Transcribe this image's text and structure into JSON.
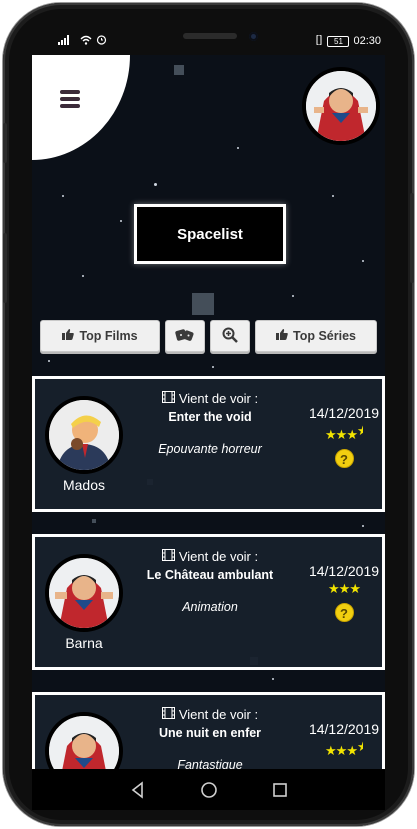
{
  "status": {
    "signal": "4G",
    "carrier_icons": "wifi alarm",
    "battery": "51",
    "time": "02:30"
  },
  "app": {
    "title": "Spacelist"
  },
  "buttons": {
    "top_films": "Top Films",
    "top_series": "Top Séries",
    "random_icon": "dice-icon",
    "search_icon": "zoom-in-icon"
  },
  "cards": [
    {
      "user": "Mados",
      "label": "Vient de voir :",
      "film": "Enter the void",
      "genre": "Epouvante horreur",
      "date": "14/12/2019",
      "rating_stars": 3.5
    },
    {
      "user": "Barna",
      "label": "Vient de voir :",
      "film": "Le Château ambulant",
      "genre": "Animation",
      "date": "14/12/2019",
      "rating_stars": 3
    },
    {
      "user": "",
      "label": "Vient de voir :",
      "film": "Une nuit en enfer",
      "genre": "Fantastique",
      "date": "14/12/2019",
      "rating_stars": 3.5
    }
  ],
  "colors": {
    "accent": "#f2e400",
    "background": "#0b1018",
    "card_border": "#ffffff"
  }
}
